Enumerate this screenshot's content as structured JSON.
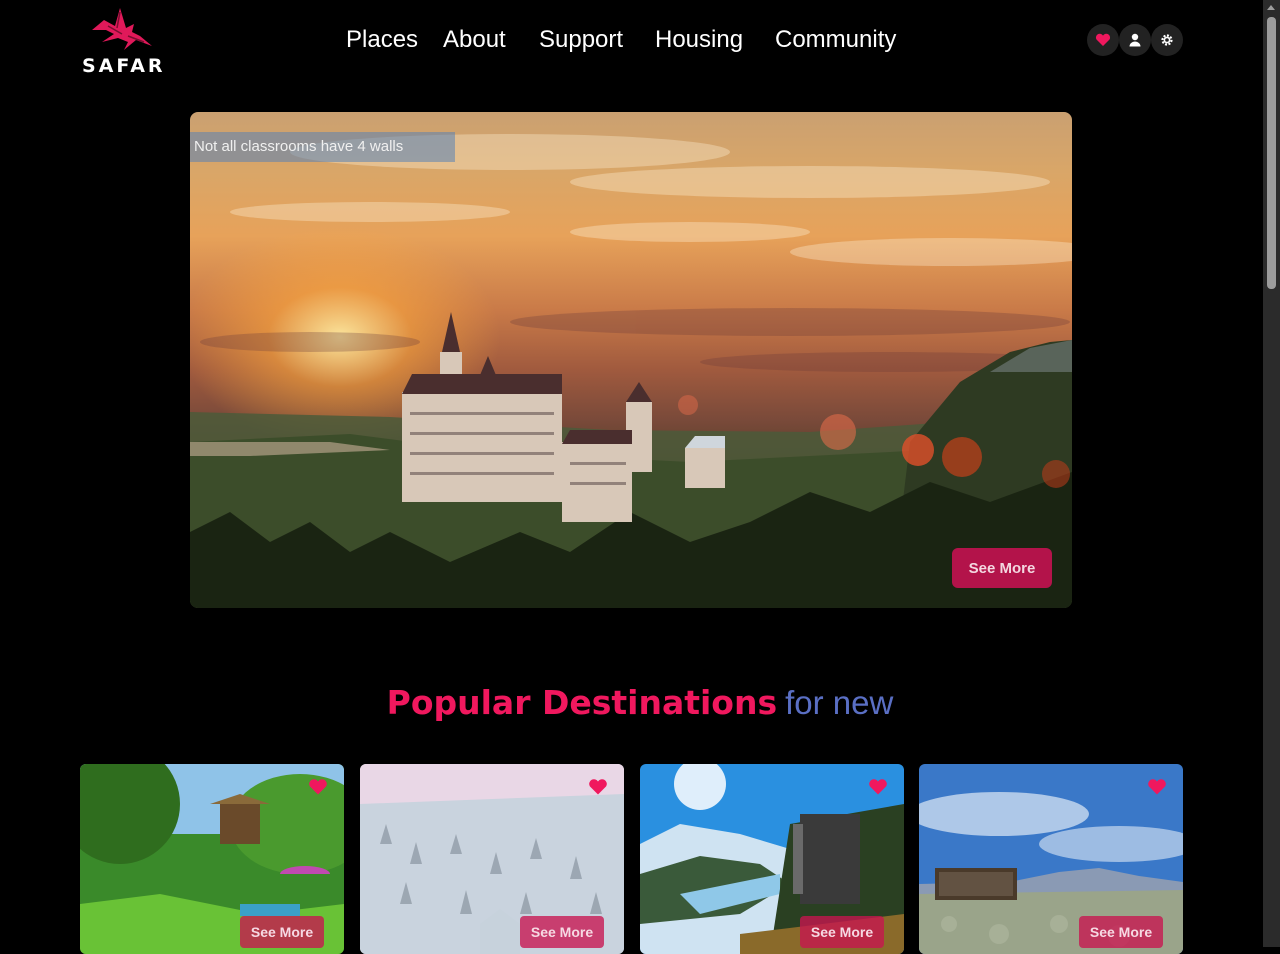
{
  "brand": {
    "name": "SAFAR",
    "accent": "#f0185e"
  },
  "nav": {
    "items": [
      {
        "label": "Places"
      },
      {
        "label": "About"
      },
      {
        "label": "Support"
      },
      {
        "label": "Housing"
      },
      {
        "label": "Community"
      }
    ]
  },
  "header_icons": [
    "heart-icon",
    "user-icon",
    "gear-icon"
  ],
  "hero": {
    "caption": "Not all classrooms have 4 walls",
    "button_label": "See More"
  },
  "section": {
    "title": "Popular Destinations",
    "subtitle": "for new"
  },
  "cards": [
    {
      "button_label": "See More",
      "icon": "heart-icon"
    },
    {
      "button_label": "See More",
      "icon": "heart-icon"
    },
    {
      "button_label": "See More",
      "icon": "heart-icon"
    },
    {
      "button_label": "See More",
      "icon": "heart-icon"
    }
  ]
}
